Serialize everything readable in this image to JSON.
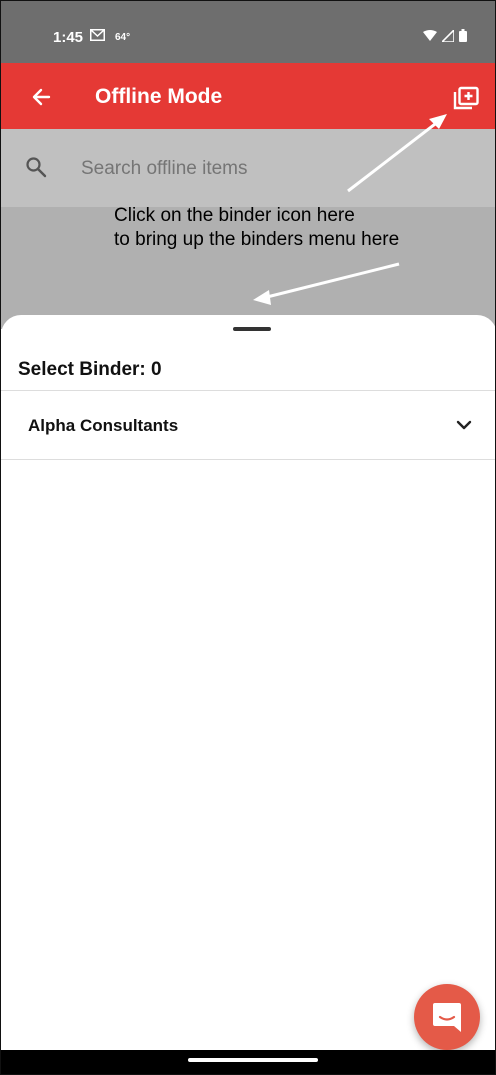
{
  "status_bar": {
    "time": "1:45",
    "temperature": "64°"
  },
  "app_bar": {
    "title": "Offline Mode",
    "color": "#e53935"
  },
  "search": {
    "placeholder": "Search offline items"
  },
  "annotation": {
    "text": "Click on the binder icon here\nto bring up the binders menu here"
  },
  "sheet": {
    "title": "Select Binder: 0",
    "binders": [
      {
        "label": "Alpha Consultants"
      }
    ]
  },
  "icons": {
    "back": "arrow-left-icon",
    "binder": "add-to-folder-icon",
    "search": "search-icon",
    "expand": "chevron-down-icon",
    "chat": "chat-bubble-icon"
  },
  "colors": {
    "accent": "#e53935",
    "fab": "#e45a48"
  }
}
